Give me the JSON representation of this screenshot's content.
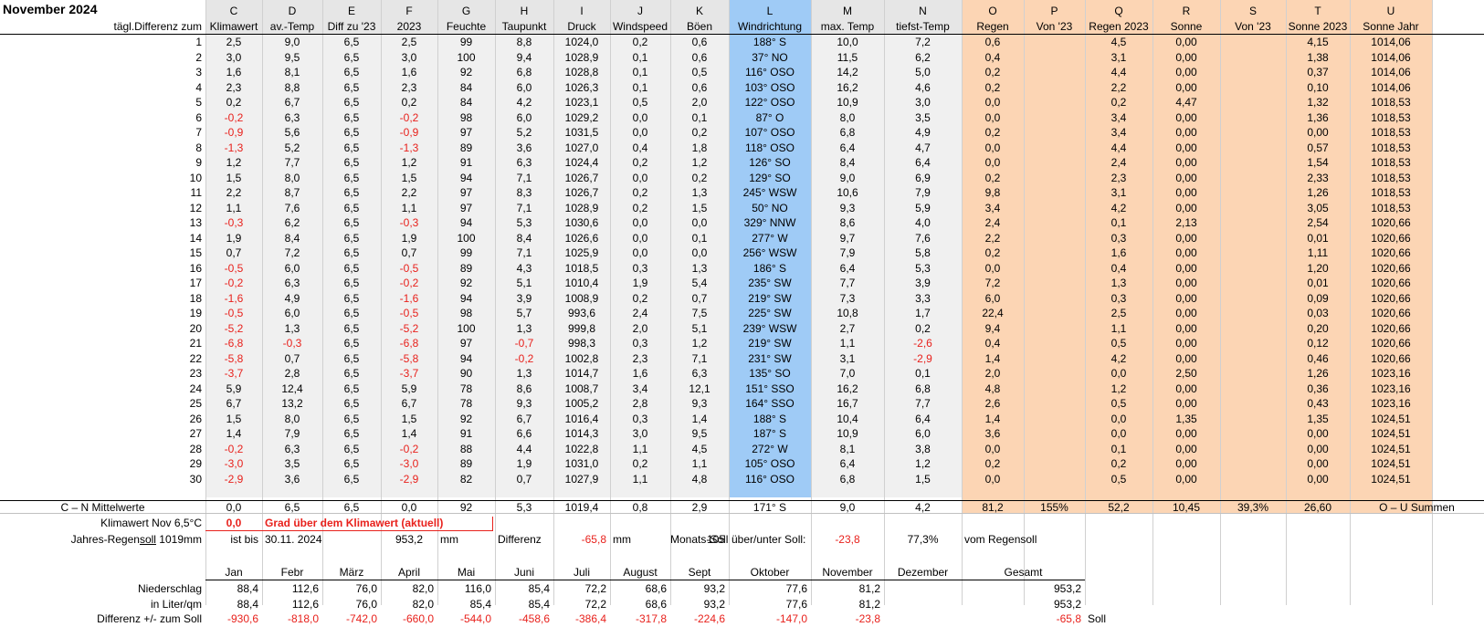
{
  "title": "November 2024",
  "col_letters": [
    "C",
    "D",
    "E",
    "F",
    "G",
    "H",
    "I",
    "J",
    "K",
    "L",
    "M",
    "N",
    "O",
    "P",
    "Q",
    "R",
    "S",
    "T",
    "U"
  ],
  "row_label_header": "tägl.Differenz zum",
  "col_headers": [
    "Klimawert",
    "av.-Temp",
    "Diff zu '23",
    "2023",
    "Feuchte",
    "Taupunkt",
    "Druck",
    "Windspeed",
    "Böen",
    "Windrichtung",
    "max. Temp",
    "tiefst-Temp",
    "Regen",
    "Von '23",
    "Regen 2023",
    "Sonne",
    "Von '23",
    "Sonne 2023",
    "Sonne Jahr"
  ],
  "rows": [
    [
      "1",
      "2,5",
      "9,0",
      "6,5",
      "2,5",
      "99",
      "8,8",
      "1024,0",
      "0,2",
      "0,6",
      "188° S",
      "10,0",
      "7,2",
      "0,6",
      "",
      "4,5",
      "0,00",
      "",
      "4,15",
      "1014,06"
    ],
    [
      "2",
      "3,0",
      "9,5",
      "6,5",
      "3,0",
      "100",
      "9,4",
      "1028,9",
      "0,1",
      "0,6",
      "37° NO",
      "11,5",
      "6,2",
      "0,4",
      "",
      "3,1",
      "0,00",
      "",
      "1,38",
      "1014,06"
    ],
    [
      "3",
      "1,6",
      "8,1",
      "6,5",
      "1,6",
      "92",
      "6,8",
      "1028,8",
      "0,1",
      "0,5",
      "116° OSO",
      "14,2",
      "5,0",
      "0,2",
      "",
      "4,4",
      "0,00",
      "",
      "0,37",
      "1014,06"
    ],
    [
      "4",
      "2,3",
      "8,8",
      "6,5",
      "2,3",
      "84",
      "6,0",
      "1026,3",
      "0,1",
      "0,6",
      "103° OSO",
      "16,2",
      "4,6",
      "0,2",
      "",
      "2,2",
      "0,00",
      "",
      "0,10",
      "1014,06"
    ],
    [
      "5",
      "0,2",
      "6,7",
      "6,5",
      "0,2",
      "84",
      "4,2",
      "1023,1",
      "0,5",
      "2,0",
      "122° OSO",
      "10,9",
      "3,0",
      "0,0",
      "",
      "0,2",
      "4,47",
      "",
      "1,32",
      "1018,53"
    ],
    [
      "6",
      "-0,2",
      "6,3",
      "6,5",
      "-0,2",
      "98",
      "6,0",
      "1029,2",
      "0,0",
      "0,1",
      "87° O",
      "8,0",
      "3,5",
      "0,0",
      "",
      "3,4",
      "0,00",
      "",
      "1,36",
      "1018,53"
    ],
    [
      "7",
      "-0,9",
      "5,6",
      "6,5",
      "-0,9",
      "97",
      "5,2",
      "1031,5",
      "0,0",
      "0,2",
      "107° OSO",
      "6,8",
      "4,9",
      "0,2",
      "",
      "3,4",
      "0,00",
      "",
      "0,00",
      "1018,53"
    ],
    [
      "8",
      "-1,3",
      "5,2",
      "6,5",
      "-1,3",
      "89",
      "3,6",
      "1027,0",
      "0,4",
      "1,8",
      "118° OSO",
      "6,4",
      "4,7",
      "0,0",
      "",
      "4,4",
      "0,00",
      "",
      "0,57",
      "1018,53"
    ],
    [
      "9",
      "1,2",
      "7,7",
      "6,5",
      "1,2",
      "91",
      "6,3",
      "1024,4",
      "0,2",
      "1,2",
      "126° SO",
      "8,4",
      "6,4",
      "0,0",
      "",
      "2,4",
      "0,00",
      "",
      "1,54",
      "1018,53"
    ],
    [
      "10",
      "1,5",
      "8,0",
      "6,5",
      "1,5",
      "94",
      "7,1",
      "1026,7",
      "0,0",
      "0,2",
      "129° SO",
      "9,0",
      "6,9",
      "0,2",
      "",
      "2,3",
      "0,00",
      "",
      "2,33",
      "1018,53"
    ],
    [
      "11",
      "2,2",
      "8,7",
      "6,5",
      "2,2",
      "97",
      "8,3",
      "1026,7",
      "0,2",
      "1,3",
      "245° WSW",
      "10,6",
      "7,9",
      "9,8",
      "",
      "3,1",
      "0,00",
      "",
      "1,26",
      "1018,53"
    ],
    [
      "12",
      "1,1",
      "7,6",
      "6,5",
      "1,1",
      "97",
      "7,1",
      "1028,9",
      "0,2",
      "1,5",
      "50° NO",
      "9,3",
      "5,9",
      "3,4",
      "",
      "4,2",
      "0,00",
      "",
      "3,05",
      "1018,53"
    ],
    [
      "13",
      "-0,3",
      "6,2",
      "6,5",
      "-0,3",
      "94",
      "5,3",
      "1030,6",
      "0,0",
      "0,0",
      "329° NNW",
      "8,6",
      "4,0",
      "2,4",
      "",
      "0,1",
      "2,13",
      "",
      "2,54",
      "1020,66"
    ],
    [
      "14",
      "1,9",
      "8,4",
      "6,5",
      "1,9",
      "100",
      "8,4",
      "1026,6",
      "0,0",
      "0,1",
      "277° W",
      "9,7",
      "7,6",
      "2,2",
      "",
      "0,3",
      "0,00",
      "",
      "0,01",
      "1020,66"
    ],
    [
      "15",
      "0,7",
      "7,2",
      "6,5",
      "0,7",
      "99",
      "7,1",
      "1025,9",
      "0,0",
      "0,0",
      "256° WSW",
      "7,9",
      "5,8",
      "0,2",
      "",
      "1,6",
      "0,00",
      "",
      "1,11",
      "1020,66"
    ],
    [
      "16",
      "-0,5",
      "6,0",
      "6,5",
      "-0,5",
      "89",
      "4,3",
      "1018,5",
      "0,3",
      "1,3",
      "186° S",
      "6,4",
      "5,3",
      "0,0",
      "",
      "0,4",
      "0,00",
      "",
      "1,20",
      "1020,66"
    ],
    [
      "17",
      "-0,2",
      "6,3",
      "6,5",
      "-0,2",
      "92",
      "5,1",
      "1010,4",
      "1,9",
      "5,4",
      "235° SW",
      "7,7",
      "3,9",
      "7,2",
      "",
      "1,3",
      "0,00",
      "",
      "0,01",
      "1020,66"
    ],
    [
      "18",
      "-1,6",
      "4,9",
      "6,5",
      "-1,6",
      "94",
      "3,9",
      "1008,9",
      "0,2",
      "0,7",
      "219° SW",
      "7,3",
      "3,3",
      "6,0",
      "",
      "0,3",
      "0,00",
      "",
      "0,09",
      "1020,66"
    ],
    [
      "19",
      "-0,5",
      "6,0",
      "6,5",
      "-0,5",
      "98",
      "5,7",
      "993,6",
      "2,4",
      "7,5",
      "225° SW",
      "10,8",
      "1,7",
      "22,4",
      "",
      "2,5",
      "0,00",
      "",
      "0,03",
      "1020,66"
    ],
    [
      "20",
      "-5,2",
      "1,3",
      "6,5",
      "-5,2",
      "100",
      "1,3",
      "999,8",
      "2,0",
      "5,1",
      "239° WSW",
      "2,7",
      "0,2",
      "9,4",
      "",
      "1,1",
      "0,00",
      "",
      "0,20",
      "1020,66"
    ],
    [
      "21",
      "-6,8",
      "-0,3",
      "6,5",
      "-6,8",
      "97",
      "-0,7",
      "998,3",
      "0,3",
      "1,2",
      "219° SW",
      "1,1",
      "-2,6",
      "0,4",
      "",
      "0,5",
      "0,00",
      "",
      "0,12",
      "1020,66"
    ],
    [
      "22",
      "-5,8",
      "0,7",
      "6,5",
      "-5,8",
      "94",
      "-0,2",
      "1002,8",
      "2,3",
      "7,1",
      "231° SW",
      "3,1",
      "-2,9",
      "1,4",
      "",
      "4,2",
      "0,00",
      "",
      "0,46",
      "1020,66"
    ],
    [
      "23",
      "-3,7",
      "2,8",
      "6,5",
      "-3,7",
      "90",
      "1,3",
      "1014,7",
      "1,6",
      "6,3",
      "135° SO",
      "7,0",
      "0,1",
      "2,0",
      "",
      "0,0",
      "2,50",
      "",
      "1,26",
      "1023,16"
    ],
    [
      "24",
      "5,9",
      "12,4",
      "6,5",
      "5,9",
      "78",
      "8,6",
      "1008,7",
      "3,4",
      "12,1",
      "151° SSO",
      "16,2",
      "6,8",
      "4,8",
      "",
      "1,2",
      "0,00",
      "",
      "0,36",
      "1023,16"
    ],
    [
      "25",
      "6,7",
      "13,2",
      "6,5",
      "6,7",
      "78",
      "9,3",
      "1005,2",
      "2,8",
      "9,3",
      "164° SSO",
      "16,7",
      "7,7",
      "2,6",
      "",
      "0,5",
      "0,00",
      "",
      "0,43",
      "1023,16"
    ],
    [
      "26",
      "1,5",
      "8,0",
      "6,5",
      "1,5",
      "92",
      "6,7",
      "1016,4",
      "0,3",
      "1,4",
      "188° S",
      "10,4",
      "6,4",
      "1,4",
      "",
      "0,0",
      "1,35",
      "",
      "1,35",
      "1024,51"
    ],
    [
      "27",
      "1,4",
      "7,9",
      "6,5",
      "1,4",
      "91",
      "6,6",
      "1014,3",
      "3,0",
      "9,5",
      "187° S",
      "10,9",
      "6,0",
      "3,6",
      "",
      "0,0",
      "0,00",
      "",
      "0,00",
      "1024,51"
    ],
    [
      "28",
      "-0,2",
      "6,3",
      "6,5",
      "-0,2",
      "88",
      "4,4",
      "1022,8",
      "1,1",
      "4,5",
      "272° W",
      "8,1",
      "3,8",
      "0,0",
      "",
      "0,1",
      "0,00",
      "",
      "0,00",
      "1024,51"
    ],
    [
      "29",
      "-3,0",
      "3,5",
      "6,5",
      "-3,0",
      "89",
      "1,9",
      "1031,0",
      "0,2",
      "1,1",
      "105° OSO",
      "6,4",
      "1,2",
      "0,2",
      "",
      "0,2",
      "0,00",
      "",
      "0,00",
      "1024,51"
    ],
    [
      "30",
      "-2,9",
      "3,6",
      "6,5",
      "-2,9",
      "82",
      "0,7",
      "1027,9",
      "1,1",
      "4,8",
      "116° OSO",
      "6,8",
      "1,5",
      "0,0",
      "",
      "0,5",
      "0,00",
      "",
      "0,00",
      "1024,51"
    ]
  ],
  "summary": {
    "label": "C – N Mittelwerte",
    "values": [
      "0,0",
      "6,5",
      "6,5",
      "0,0",
      "92",
      "5,3",
      "1019,4",
      "0,8",
      "2,9",
      "171° S",
      "9,0",
      "4,2",
      "81,2",
      "155%",
      "52,2",
      "10,45",
      "39,3%",
      "26,60",
      "O – U Summen"
    ]
  },
  "klima": {
    "label": "Klimawert Nov 6,5°C",
    "value": "0,0",
    "text": "Grad über dem Klimawert (aktuell)"
  },
  "jahr": {
    "label_pre": "Jahres-Regen",
    "label_soll": "soll",
    "label_post": " 1019mm",
    "bis": "ist bis",
    "date": "30.11. 2024",
    "amount": "953,2",
    "unit": "mm",
    "diff_label": "Differenz",
    "diff_value": "-65,8",
    "diff_unit": "mm",
    "monats_label": "Monats-Soll",
    "monats_value": "105",
    "ueber_label": "über/unter Soll:",
    "ueber_value": "-23,8",
    "pct": "77,3%",
    "vom": "vom Regensoll"
  },
  "months": {
    "headers": [
      "Jan",
      "Febr",
      "März",
      "April",
      "Mai",
      "Juni",
      "Juli",
      "August",
      "Sept",
      "Oktober",
      "November",
      "Dezember",
      "Gesamt"
    ],
    "rows": [
      {
        "label": "Niederschlag",
        "values": [
          "88,4",
          "112,6",
          "76,0",
          "82,0",
          "116,0",
          "85,4",
          "72,2",
          "68,6",
          "93,2",
          "77,6",
          "81,2",
          "",
          "953,2"
        ]
      },
      {
        "label": "in Liter/qm",
        "values": [
          "88,4",
          "112,6",
          "76,0",
          "82,0",
          "85,4",
          "85,4",
          "72,2",
          "68,6",
          "93,2",
          "77,6",
          "81,2",
          "",
          "953,2"
        ]
      },
      {
        "label": "Differenz  +/- zum Soll",
        "values": [
          "-930,6",
          "-818,0",
          "-742,0",
          "-660,0",
          "-544,0",
          "-458,6",
          "-386,4",
          "-317,8",
          "-224,6",
          "-147,0",
          "-23,8",
          "",
          "-65,8"
        ],
        "extra": "Soll"
      }
    ]
  },
  "colors": {
    "header_band": "#e6e6e6",
    "data_band": "#f0f0f0",
    "wind_col": "#9fcbf6",
    "orange": "#fcd5b4",
    "negative": "#e8211c"
  }
}
